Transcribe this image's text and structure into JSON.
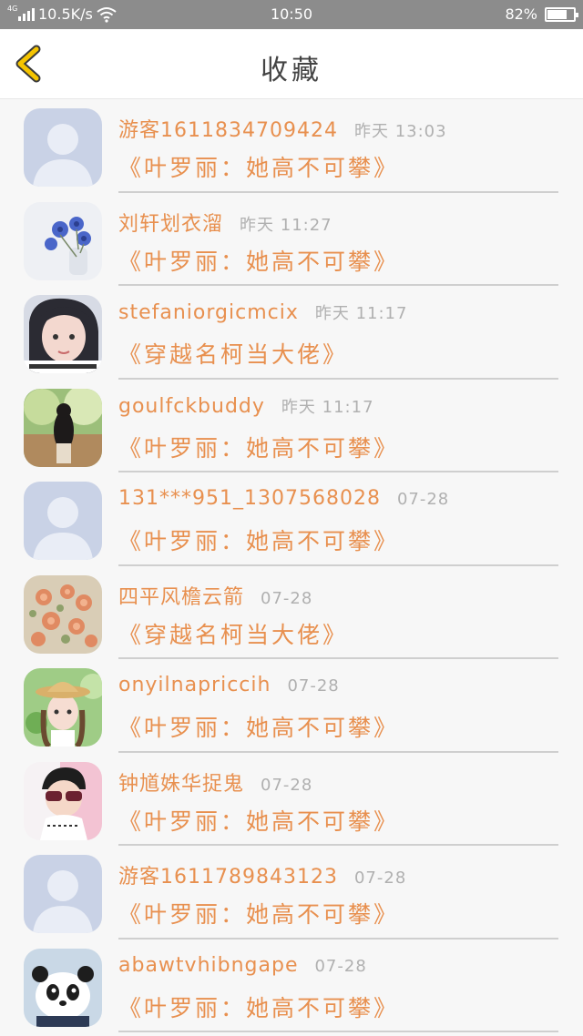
{
  "status_bar": {
    "network_tag": "4G",
    "speed": "10.5K/s",
    "time": "10:50",
    "battery": "82%",
    "battery_level": 0.82
  },
  "header": {
    "title": "收藏",
    "back_icon": "chevron-left-icon",
    "accent_color": "#f5c400"
  },
  "items": [
    {
      "user": "游客1611834709424",
      "time": "昨天 13:03",
      "title": "《叶罗丽：她高不可攀》",
      "avatar": "default"
    },
    {
      "user": "刘轩划衣溜",
      "time": "昨天 11:27",
      "title": "《叶罗丽：她高不可攀》",
      "avatar": "flowers"
    },
    {
      "user": "stefaniorgicmcix",
      "time": "昨天 11:17",
      "title": "《穿越名柯当大佬》",
      "avatar": "girl"
    },
    {
      "user": "goulfckbuddy",
      "time": "昨天 11:17",
      "title": "《叶罗丽：她高不可攀》",
      "avatar": "forest"
    },
    {
      "user": "131***951_1307568028",
      "time": "07-28",
      "title": "《叶罗丽：她高不可攀》",
      "avatar": "default"
    },
    {
      "user": "四平风檐云箭",
      "time": "07-28",
      "title": "《穿越名柯当大佬》",
      "avatar": "roses"
    },
    {
      "user": "onyilnapriccih",
      "time": "07-28",
      "title": "《叶罗丽：她高不可攀》",
      "avatar": "hat-girl"
    },
    {
      "user": "钟馗姝华捉鬼",
      "time": "07-28",
      "title": "《叶罗丽：她高不可攀》",
      "avatar": "boy"
    },
    {
      "user": "游客1611789843123",
      "time": "07-28",
      "title": "《叶罗丽：她高不可攀》",
      "avatar": "default"
    },
    {
      "user": "abawtvhibngape",
      "time": "07-28",
      "title": "《叶罗丽：她高不可攀》",
      "avatar": "panda"
    }
  ],
  "colors": {
    "accent_text": "#e8904f",
    "time_text": "#b0b0b0",
    "default_avatar_bg": "#c9d2e6"
  }
}
